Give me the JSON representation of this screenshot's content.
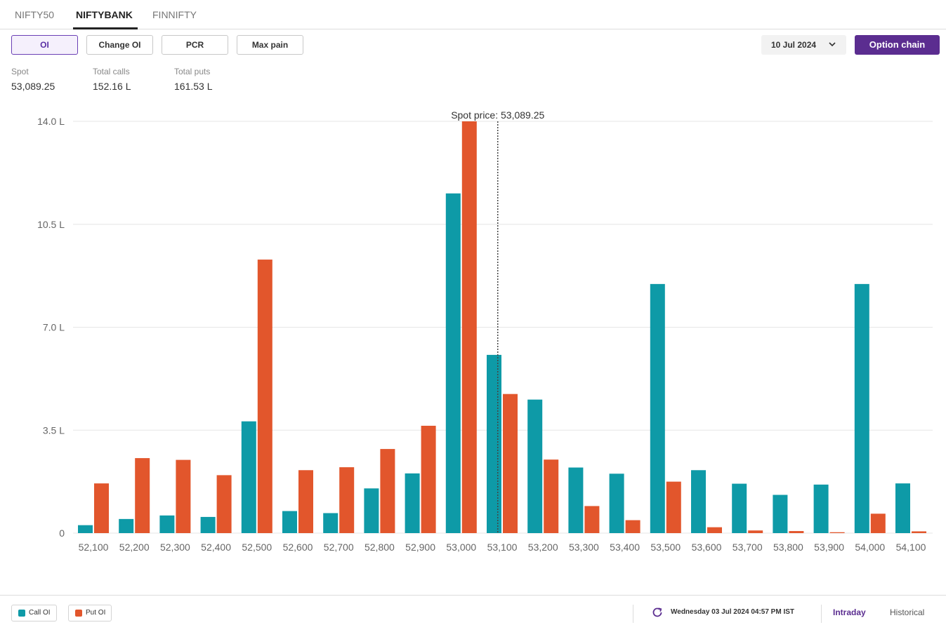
{
  "tabs": [
    {
      "label": "NIFTY50",
      "active": false
    },
    {
      "label": "NIFTYBANK",
      "active": true
    },
    {
      "label": "FINNIFTY",
      "active": false
    }
  ],
  "toolbar": {
    "buttons": [
      {
        "label": "OI",
        "active": true
      },
      {
        "label": "Change OI",
        "active": false
      },
      {
        "label": "PCR",
        "active": false
      },
      {
        "label": "Max pain",
        "active": false
      }
    ],
    "expiry_date": "10 Jul 2024",
    "option_chain_label": "Option chain"
  },
  "stats": [
    {
      "label": "Spot",
      "value": "53,089.25"
    },
    {
      "label": "Total calls",
      "value": "152.16 L"
    },
    {
      "label": "Total puts",
      "value": "161.53 L"
    }
  ],
  "chart_data": {
    "type": "bar",
    "categories": [
      "52,100",
      "52,200",
      "52,300",
      "52,400",
      "52,500",
      "52,600",
      "52,700",
      "52,800",
      "52,900",
      "53,000",
      "53,100",
      "53,200",
      "53,300",
      "53,400",
      "53,500",
      "53,600",
      "53,700",
      "53,800",
      "53,900",
      "54,000",
      "54,100"
    ],
    "series": [
      {
        "name": "Call OI",
        "color": "#0e9aa7",
        "values": [
          0.27,
          0.48,
          0.6,
          0.55,
          3.8,
          0.75,
          0.68,
          1.52,
          2.03,
          11.55,
          6.06,
          4.54,
          2.23,
          2.02,
          8.47,
          2.14,
          1.68,
          1.3,
          1.65,
          8.47,
          1.69
        ]
      },
      {
        "name": "Put OI",
        "color": "#e2562c",
        "values": [
          1.69,
          2.55,
          2.49,
          1.97,
          9.3,
          2.14,
          2.24,
          2.86,
          3.65,
          14.0,
          4.73,
          2.5,
          0.92,
          0.44,
          1.75,
          0.2,
          0.09,
          0.07,
          0.03,
          0.66,
          0.06
        ]
      }
    ],
    "y_ticks": [
      "0",
      "3.5 L",
      "7.0 L",
      "10.5 L",
      "14.0 L"
    ],
    "y_tick_values": [
      0,
      3.5,
      7.0,
      10.5,
      14.0
    ],
    "ylim": [
      0,
      14.0
    ],
    "grid": true,
    "spot_price": 53089.25,
    "spot_label": "Spot price: 53,089.25",
    "strike_values": [
      52100,
      52200,
      52300,
      52400,
      52500,
      52600,
      52700,
      52800,
      52900,
      53000,
      53100,
      53200,
      53300,
      53400,
      53500,
      53600,
      53700,
      53800,
      53900,
      54000,
      54100
    ]
  },
  "footer": {
    "legend": [
      {
        "label": "Call OI",
        "color": "#0e9aa7"
      },
      {
        "label": "Put OI",
        "color": "#e2562c"
      }
    ],
    "timestamp": "Wednesday 03 Jul 2024 04:57 PM IST",
    "links": [
      {
        "label": "Intraday",
        "active": true
      },
      {
        "label": "Historical",
        "active": false
      }
    ]
  }
}
